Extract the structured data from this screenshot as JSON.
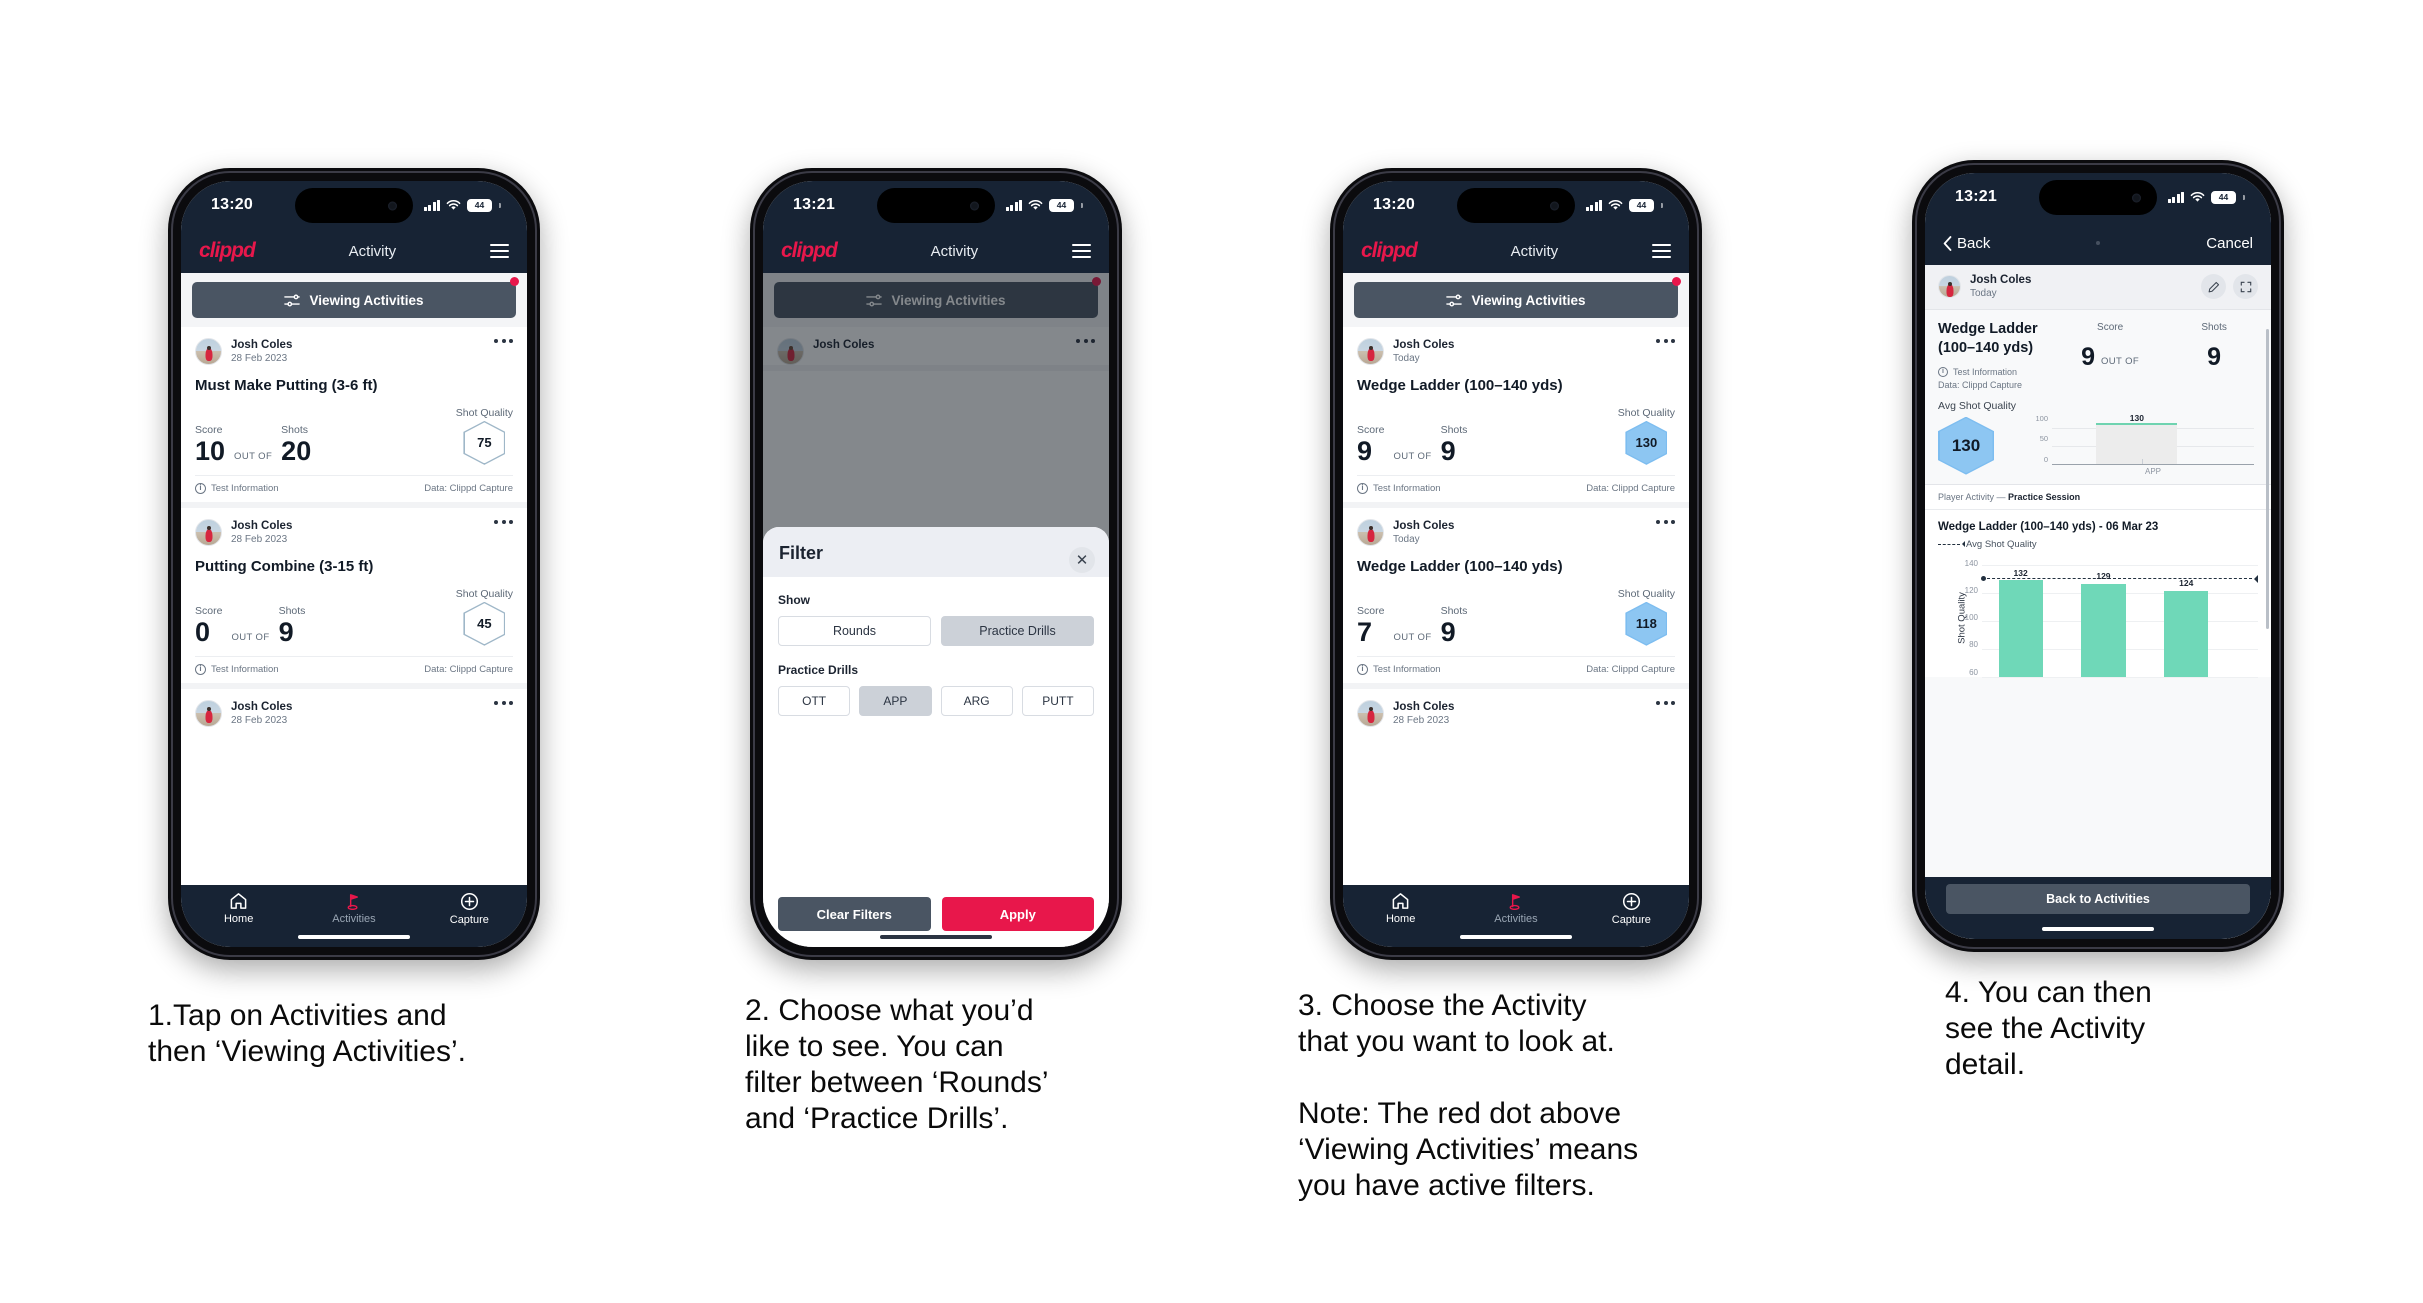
{
  "steps": [
    {
      "caption": "1.Tap on Activities and\nthen ‘Viewing Activities’.",
      "status": {
        "time": "13:20",
        "battery": "44"
      },
      "nav": {
        "brand": "clippd",
        "title": "Activity"
      },
      "filter_bar": {
        "label": "Viewing Activities"
      },
      "cards": [
        {
          "user": "Josh Coles",
          "date": "28 Feb 2023",
          "title": "Must Make Putting (3-6 ft)",
          "score_label": "Score",
          "shots_label": "Shots",
          "quality_label": "Shot Quality",
          "score": "10",
          "out_of": "OUT OF",
          "shots": "20",
          "quality": "75",
          "quality_style": "light",
          "foot_left": "Test Information",
          "foot_right": "Data: Clippd Capture"
        },
        {
          "user": "Josh Coles",
          "date": "28 Feb 2023",
          "title": "Putting Combine (3-15 ft)",
          "score_label": "Score",
          "shots_label": "Shots",
          "quality_label": "Shot Quality",
          "score": "0",
          "out_of": "OUT OF",
          "shots": "9",
          "quality": "45",
          "quality_style": "light",
          "foot_left": "Test Information",
          "foot_right": "Data: Clippd Capture"
        },
        {
          "user": "Josh Coles",
          "date": "28 Feb 2023",
          "partial": true
        }
      ],
      "tabs": [
        {
          "label": "Home",
          "icon": "home-icon",
          "active": false
        },
        {
          "label": "Activities",
          "icon": "golf-flag-icon",
          "active": true
        },
        {
          "label": "Capture",
          "icon": "plus-circle-icon",
          "active": false
        }
      ]
    },
    {
      "caption": "2. Choose what you’d\nlike to see. You can\nfilter between ‘Rounds’\nand ‘Practice Drills’.",
      "status": {
        "time": "13:21",
        "battery": "44"
      },
      "nav": {
        "brand": "clippd",
        "title": "Activity"
      },
      "filter_bar": {
        "label": "Viewing Activities"
      },
      "behind_card": {
        "user": "Josh Coles"
      },
      "modal": {
        "title": "Filter",
        "close_icon": "close-icon",
        "show_label": "Show",
        "show_options": [
          {
            "label": "Rounds",
            "selected": false
          },
          {
            "label": "Practice Drills",
            "selected": true
          }
        ],
        "drills_label": "Practice Drills",
        "drill_options": [
          {
            "label": "OTT",
            "selected": false
          },
          {
            "label": "APP",
            "selected": true
          },
          {
            "label": "ARG",
            "selected": false
          },
          {
            "label": "PUTT",
            "selected": false
          }
        ],
        "clear_label": "Clear Filters",
        "apply_label": "Apply"
      }
    },
    {
      "caption": "3. Choose the Activity\nthat you want to look at.\n\nNote: The red dot above\n‘Viewing Activities’ means\nyou have active filters.",
      "status": {
        "time": "13:20",
        "battery": "44"
      },
      "nav": {
        "brand": "clippd",
        "title": "Activity"
      },
      "filter_bar": {
        "label": "Viewing Activities"
      },
      "cards": [
        {
          "user": "Josh Coles",
          "date": "Today",
          "title": "Wedge Ladder (100–140 yds)",
          "score_label": "Score",
          "shots_label": "Shots",
          "quality_label": "Shot Quality",
          "score": "9",
          "out_of": "OUT OF",
          "shots": "9",
          "quality": "130",
          "quality_style": "blue",
          "foot_left": "Test Information",
          "foot_right": "Data: Clippd Capture"
        },
        {
          "user": "Josh Coles",
          "date": "Today",
          "title": "Wedge Ladder (100–140 yds)",
          "score_label": "Score",
          "shots_label": "Shots",
          "quality_label": "Shot Quality",
          "score": "7",
          "out_of": "OUT OF",
          "shots": "9",
          "quality": "118",
          "quality_style": "blue",
          "foot_left": "Test Information",
          "foot_right": "Data: Clippd Capture"
        },
        {
          "user": "Josh Coles",
          "date": "28 Feb 2023",
          "partial": true
        }
      ],
      "tabs": [
        {
          "label": "Home",
          "icon": "home-icon",
          "active": false
        },
        {
          "label": "Activities",
          "icon": "golf-flag-icon",
          "active": true
        },
        {
          "label": "Capture",
          "icon": "plus-circle-icon",
          "active": false
        }
      ]
    },
    {
      "caption": "4. You can then\nsee the Activity\ndetail.",
      "status": {
        "time": "13:21",
        "battery": "44"
      },
      "nav": {
        "back_label": "Back",
        "cancel_label": "Cancel"
      },
      "detail": {
        "user": "Josh Coles",
        "date": "Today",
        "edit_icon": "pencil-icon",
        "expand_icon": "expand-icon",
        "title": "Wedge Ladder\n(100–140 yds)",
        "info_label": "Test Information",
        "data_label": "Data: Clippd Capture",
        "score_label": "Score",
        "shots_label": "Shots",
        "score": "9",
        "out_of": "OUT OF",
        "shots": "9",
        "avg_label": "Avg Shot Quality",
        "avg_value": "130",
        "section_prefix": "Player Activity —",
        "section_name": "Practice Session",
        "chart_title": "Wedge Ladder (100–140 yds) - 06 Mar 23",
        "legend": "Avg Shot Quality",
        "back_button": "Back to Activities"
      }
    }
  ],
  "chart_data": [
    {
      "type": "bar",
      "title": "Avg Shot Quality by category",
      "categories": [
        "APP"
      ],
      "values": [
        130
      ],
      "labels": [
        "130"
      ],
      "ylabel": "",
      "yticks": [
        0,
        50,
        100
      ],
      "ytick_labels": [
        "0",
        "50",
        "100"
      ],
      "ylim": [
        0,
        140
      ],
      "grid": true,
      "legend": "none"
    },
    {
      "type": "bar",
      "title": "Wedge Ladder (100–140 yds) - 06 Mar 23",
      "categories": [
        "",
        "",
        ""
      ],
      "values": [
        132,
        129,
        124
      ],
      "labels": [
        "132",
        "129",
        "124"
      ],
      "series": [
        {
          "name": "Shot Quality",
          "values": [
            132,
            129,
            124
          ]
        }
      ],
      "annotations": [
        {
          "name": "Avg Shot Quality",
          "type": "dashed-line",
          "value": 130
        }
      ],
      "ylabel": "Shot Quality",
      "yticks": [
        60,
        80,
        100,
        120,
        140
      ],
      "ytick_labels": [
        "140",
        "120",
        "100",
        "80",
        "60"
      ],
      "ylim": [
        52,
        145
      ],
      "grid": true,
      "legend": "top-left",
      "bar_color": "#6fd8b8"
    }
  ],
  "colors": {
    "brand_red": "#e8174b",
    "nav_dark": "#172334",
    "filter_gray": "#4a5563",
    "hex_blue": "#8dc6f2",
    "bar_green": "#6fd8b8"
  }
}
